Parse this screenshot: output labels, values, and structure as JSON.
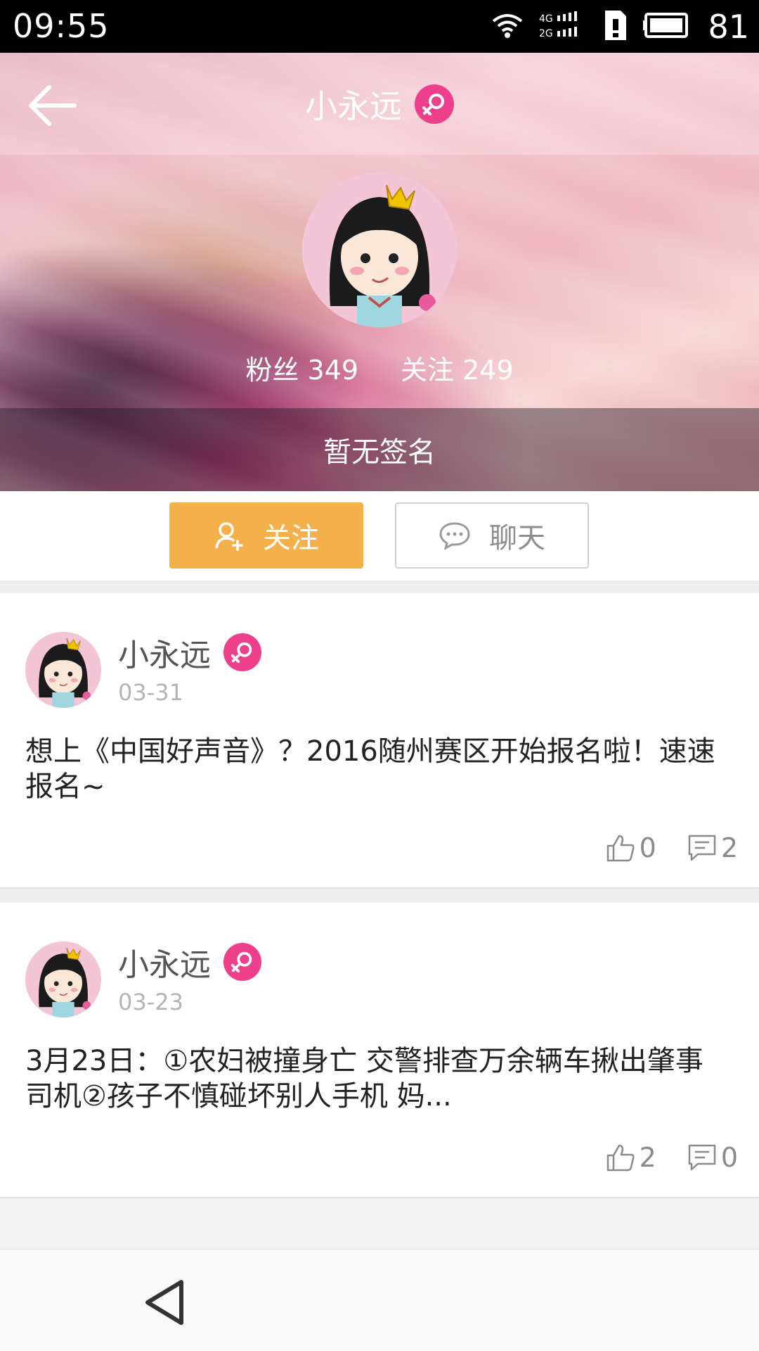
{
  "status_bar": {
    "time": "09:55",
    "battery": "81",
    "icons": [
      "wifi-icon",
      "signal-4g-2g-icon",
      "sim-icon",
      "battery-icon"
    ]
  },
  "header": {
    "title": "小永远",
    "gender": "female-icon",
    "fans_label": "粉丝",
    "fans_count": "349",
    "follow_label": "关注",
    "follow_count": "249",
    "signature": "暂无签名"
  },
  "actions": {
    "follow_label": "关注",
    "chat_label": "聊天"
  },
  "posts": [
    {
      "author": "小永远",
      "date": "03-31",
      "text": "想上《中国好声音》？2016随州赛区开始报名啦！速速报名~",
      "likes": "0",
      "comments": "2"
    },
    {
      "author": "小永远",
      "date": "03-23",
      "text": "3月23日：①农妇被撞身亡 交警排查万余辆车揪出肇事司机②孩子不慎碰坏别人手机 妈...",
      "likes": "2",
      "comments": "0"
    }
  ],
  "colors": {
    "accent_follow": "#f4b04a",
    "gender_pink": "#ee3f8c"
  }
}
